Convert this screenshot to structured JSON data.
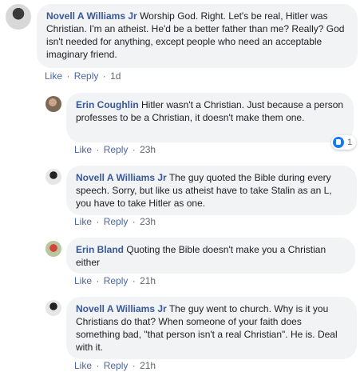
{
  "comments": [
    {
      "author": "Novell A Williams Jr",
      "text": "Worship God. Right. Let's be real, Hitler was Christian. I'm an atheist. He'd be a better father than me? Really? God isn't needed for anything, except people who need an acceptable imaginary friend.",
      "like_label": "Like",
      "reply_label": "Reply",
      "time": "1d"
    }
  ],
  "replies": [
    {
      "author": "Erin Coughlin",
      "text": "Hitler wasn't a Christian. Just because a person professes to be a Christian, it doesn't make them one.",
      "like_label": "Like",
      "reply_label": "Reply",
      "time": "23h",
      "reaction_count": "1",
      "reaction_icon": "like-icon",
      "reaction_color": "#1877f2"
    },
    {
      "author": "Novell A Williams Jr",
      "text": "The guy quoted the Bible during every speech. Sorry, but like us atheist have to take Stalin as an L, you have to take Hitler as one.",
      "like_label": "Like",
      "reply_label": "Reply",
      "time": "23h"
    },
    {
      "author": "Erin Bland",
      "text": "Quoting the Bible doesn't make you a Christian either",
      "like_label": "Like",
      "reply_label": "Reply",
      "time": "21h"
    },
    {
      "author": "Novell A Williams Jr",
      "text": "The guy went to church. Why is it you Christians do that? When someone of your faith does something bad, \"that person isn't a real Christian\". He is. Deal with it.",
      "like_label": "Like",
      "reply_label": "Reply",
      "time": "21h"
    }
  ],
  "separator": "·"
}
